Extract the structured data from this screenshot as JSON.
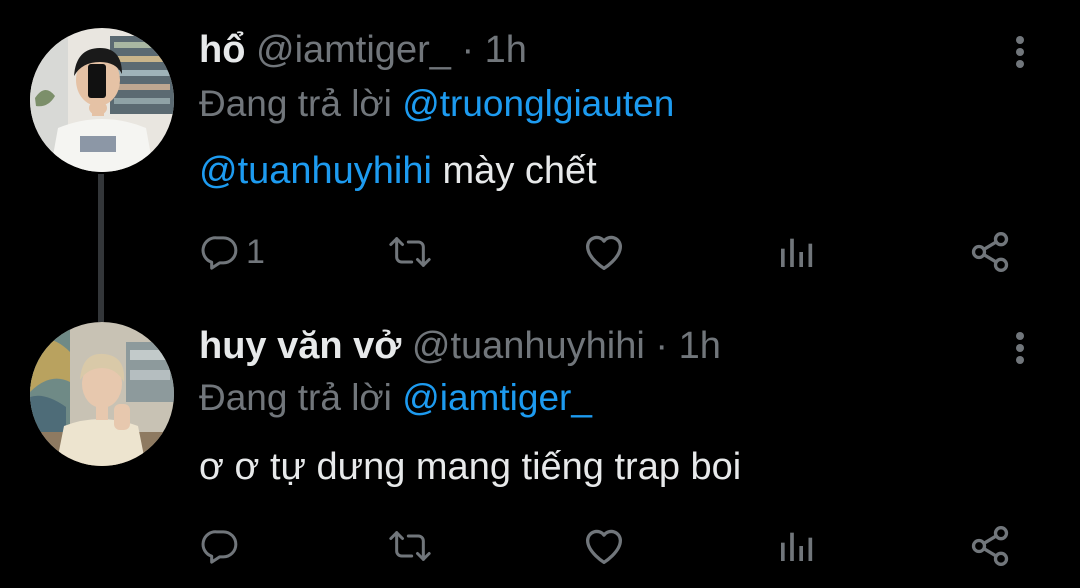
{
  "colors": {
    "background": "#000000",
    "text_primary": "#E7E9EA",
    "text_secondary": "#71767B",
    "accent": "#1D9BF0",
    "thread_line": "#333639"
  },
  "tweets": [
    {
      "display_name": "hổ",
      "handle": "@iamtiger_",
      "separator": "·",
      "time": "1h",
      "replying_label": "Đang trả lời",
      "replying_to": "@truonglgiauten",
      "body_mention": "@tuanhuyhihi",
      "body_text": " mày chết",
      "reply_count": "1",
      "avatar_icon": "user-avatar",
      "more_icon": "more-vertical-icon"
    },
    {
      "display_name": "huy văn vở",
      "handle": "@tuanhuyhihi",
      "separator": "·",
      "time": "1h",
      "replying_label": "Đang trả lời",
      "replying_to": "@iamtiger_",
      "body_mention": "",
      "body_text": "ơ ơ tự dưng mang tiếng trap boi",
      "reply_count": "",
      "avatar_icon": "user-avatar",
      "more_icon": "more-vertical-icon"
    }
  ],
  "actions": {
    "reply_icon": "reply-icon",
    "retweet_icon": "retweet-icon",
    "like_icon": "heart-icon",
    "views_icon": "views-icon",
    "share_icon": "share-icon"
  }
}
